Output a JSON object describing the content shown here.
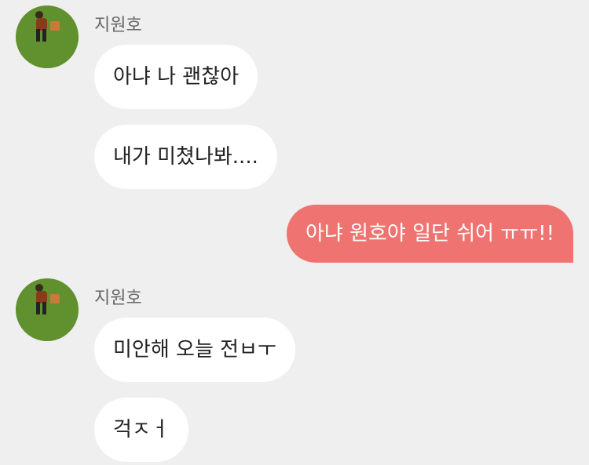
{
  "groups": [
    {
      "sender": "지원호",
      "messages": [
        "아냐 나 괜찮아",
        "내가 미쳤나봐...."
      ]
    },
    {
      "sender": "지원호",
      "messages": [
        "미안해 오늘 전ㅂㅜ",
        "걱ㅈㅓ"
      ]
    }
  ],
  "my_messages": [
    "아냐 원호야 일단 쉬어 ㅠㅠ!!"
  ],
  "colors": {
    "background": "#efefef",
    "their_bubble": "#ffffff",
    "my_bubble": "#ef7471",
    "avatar_grass": "#5a8a2c"
  }
}
